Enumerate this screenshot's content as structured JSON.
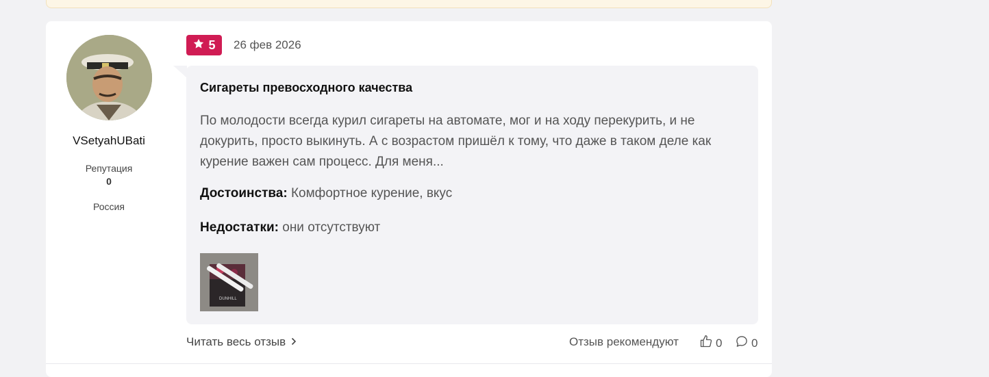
{
  "author": {
    "username": "VSetyahUBati",
    "reputation_label": "Репутация",
    "reputation_value": "0",
    "country": "Россия"
  },
  "review": {
    "rating": "5",
    "date": "26 фев 2026",
    "title": "Сигареты превосходного качества",
    "text": "По молодости всегда курил сигареты на автомате, мог и на ходу перекурить, и не докурить, просто выкинуть. А с возрастом пришёл к тому, что даже в таком деле как курение важен сам процесс. Для меня...",
    "pros_label": "Достоинства:",
    "pros_value": "Комфортное курение, вкус",
    "cons_label": "Недостатки:",
    "cons_value": "они отсутствуют",
    "thumbnail_text": "DUNHILL"
  },
  "footer": {
    "read_more": "Читать весь отзыв",
    "recommend_label": "Отзыв рекомендуют",
    "likes": "0",
    "comments": "0"
  },
  "colors": {
    "badge": "#d01c54",
    "bubble": "#f3f3f6",
    "page_bg": "#f2f2f4"
  },
  "icons": {
    "rating": "star-icon",
    "read_more": "chevron-right-icon",
    "likes": "thumbs-up-icon",
    "comments": "comment-icon"
  }
}
